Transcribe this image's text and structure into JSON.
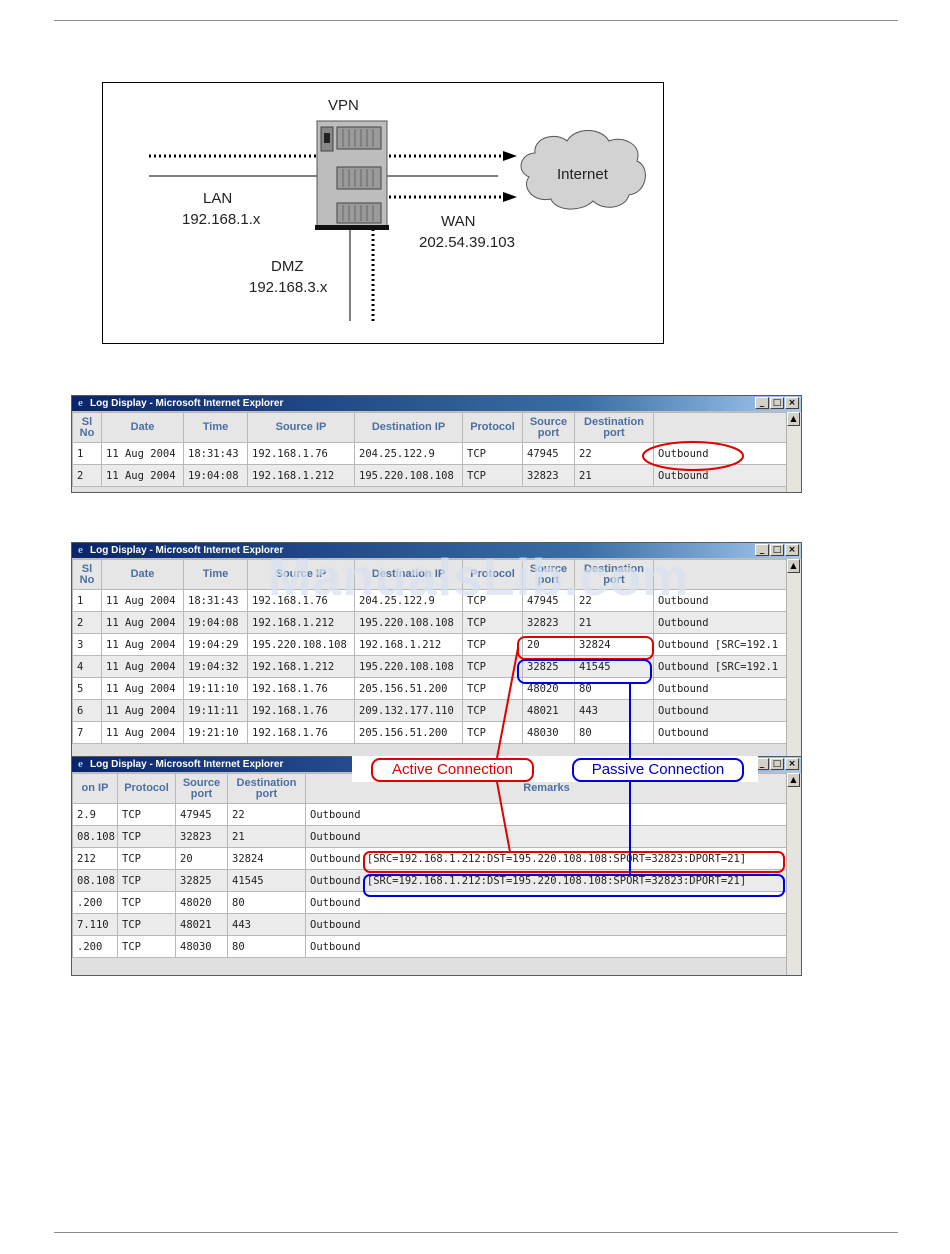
{
  "diagram": {
    "vpn": "VPN",
    "internet": "Internet",
    "lan": "LAN",
    "lan_ip": "192.168.1.x",
    "wan": "WAN",
    "wan_ip": "202.54.39.103",
    "dmz": "DMZ",
    "dmz_ip": "192.168.3.x"
  },
  "window_title": "Log Display - Microsoft Internet Explorer",
  "window_buttons": {
    "minimize": "_",
    "maximize": "□",
    "close": "×"
  },
  "scroll_up": "▲",
  "watermark": "ManualsLib.com",
  "table1": {
    "headers": [
      "Sl No",
      "Date",
      "Time",
      "Source IP",
      "Destination IP",
      "Protocol",
      "Source port",
      "Destination port",
      ""
    ],
    "rows": [
      [
        "1",
        "11 Aug 2004",
        "18:31:43",
        "192.168.1.76",
        "204.25.122.9",
        "TCP",
        "47945",
        "22",
        "Outbound"
      ],
      [
        "2",
        "11 Aug 2004",
        "19:04:08",
        "192.168.1.212",
        "195.220.108.108",
        "TCP",
        "32823",
        "21",
        "Outbound"
      ]
    ]
  },
  "table2": {
    "headers": [
      "Sl No",
      "Date",
      "Time",
      "Source IP",
      "Destination IP",
      "Protocol",
      "Source port",
      "Destination port",
      ""
    ],
    "rows": [
      [
        "1",
        "11 Aug 2004",
        "18:31:43",
        "192.168.1.76",
        "204.25.122.9",
        "TCP",
        "47945",
        "22",
        "Outbound"
      ],
      [
        "2",
        "11 Aug 2004",
        "19:04:08",
        "192.168.1.212",
        "195.220.108.108",
        "TCP",
        "32823",
        "21",
        "Outbound"
      ],
      [
        "3",
        "11 Aug 2004",
        "19:04:29",
        "195.220.108.108",
        "192.168.1.212",
        "TCP",
        "20",
        "32824",
        "Outbound [SRC=192.1"
      ],
      [
        "4",
        "11 Aug 2004",
        "19:04:32",
        "192.168.1.212",
        "195.220.108.108",
        "TCP",
        "32825",
        "41545",
        "Outbound [SRC=192.1"
      ],
      [
        "5",
        "11 Aug 2004",
        "19:11:10",
        "192.168.1.76",
        "205.156.51.200",
        "TCP",
        "48020",
        "80",
        "Outbound"
      ],
      [
        "6",
        "11 Aug 2004",
        "19:11:11",
        "192.168.1.76",
        "209.132.177.110",
        "TCP",
        "48021",
        "443",
        "Outbound"
      ],
      [
        "7",
        "11 Aug 2004",
        "19:21:10",
        "192.168.1.76",
        "205.156.51.200",
        "TCP",
        "48030",
        "80",
        "Outbound"
      ]
    ]
  },
  "table3": {
    "headers": [
      "on IP",
      "Protocol",
      "Source port",
      "Destination port",
      "Remarks"
    ],
    "rows": [
      [
        "2.9",
        "TCP",
        "47945",
        "22",
        "Outbound"
      ],
      [
        "08.108",
        "TCP",
        "32823",
        "21",
        "Outbound"
      ],
      [
        "212",
        "TCP",
        "20",
        "32824",
        "Outbound [SRC=192.168.1.212:DST=195.220.108.108:SPORT=32823:DPORT=21]"
      ],
      [
        "08.108",
        "TCP",
        "32825",
        "41545",
        "Outbound [SRC=192.168.1.212:DST=195.220.108.108:SPORT=32823:DPORT=21]"
      ],
      [
        ".200",
        "TCP",
        "48020",
        "80",
        "Outbound"
      ],
      [
        "7.110",
        "TCP",
        "48021",
        "443",
        "Outbound"
      ],
      [
        ".200",
        "TCP",
        "48030",
        "80",
        "Outbound"
      ]
    ]
  },
  "callouts": {
    "active": "Active Connection",
    "passive": "Passive Connection"
  },
  "colors": {
    "active": "#e00000",
    "passive": "#0000e0",
    "header_text": "#4d6fa0"
  }
}
